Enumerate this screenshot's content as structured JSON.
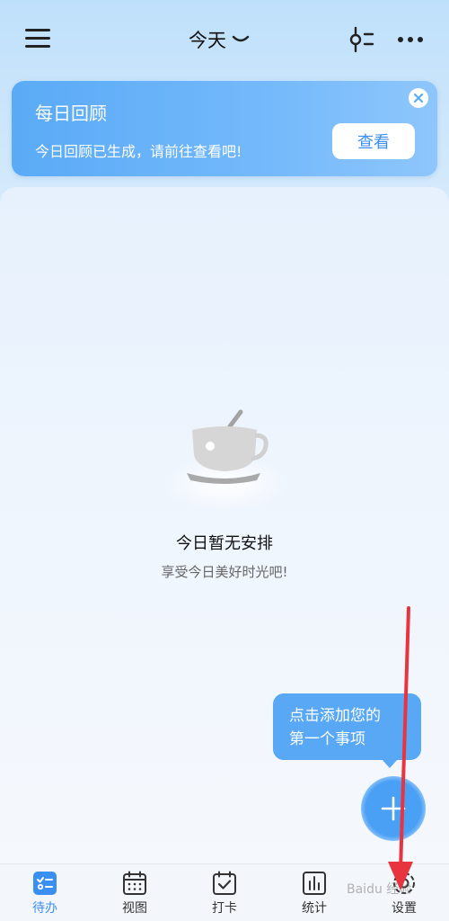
{
  "header": {
    "title": "今天",
    "icons": [
      "menu-icon",
      "chevron-down-icon",
      "filter-icon",
      "more-icon"
    ]
  },
  "review_card": {
    "title": "每日回顾",
    "subtitle": "今日回顾已生成，请前往查看吧!",
    "button_label": "查看"
  },
  "empty_state": {
    "title": "今日暂无安排",
    "subtitle": "享受今日美好时光吧!"
  },
  "tooltip": {
    "line1": "点击添加您的",
    "line2": "第一个事项"
  },
  "tabs": [
    {
      "label": "待办",
      "icon": "todo-icon",
      "active": true
    },
    {
      "label": "视图",
      "icon": "calendar-icon",
      "active": false
    },
    {
      "label": "打卡",
      "icon": "checkin-icon",
      "active": false
    },
    {
      "label": "统计",
      "icon": "stats-icon",
      "active": false
    },
    {
      "label": "设置",
      "icon": "settings-icon",
      "active": false
    }
  ],
  "watermark": "Baidu 经验",
  "colors": {
    "accent": "#3b8ff0",
    "card": "#5aaaf6",
    "annotation_arrow": "#e8343f"
  }
}
